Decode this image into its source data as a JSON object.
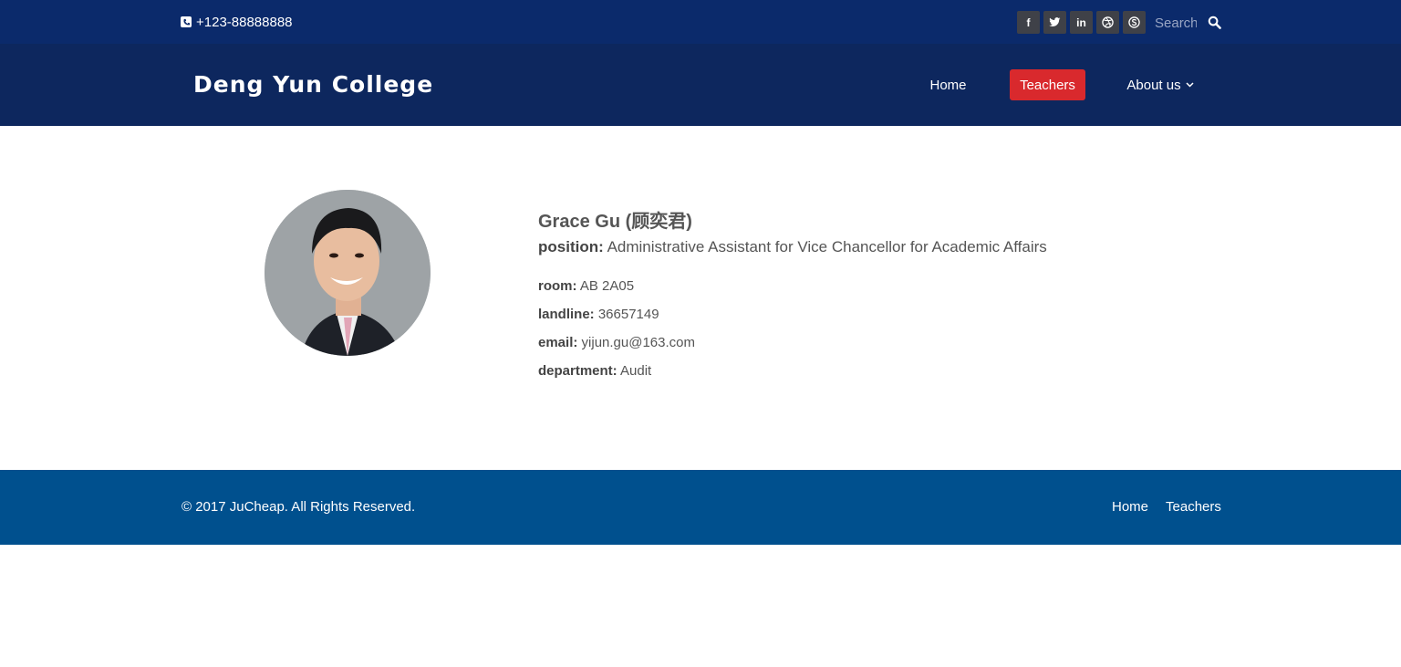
{
  "topbar": {
    "phone": "+123-88888888",
    "social": [
      {
        "glyph": "f",
        "icon": "facebook-icon"
      },
      {
        "glyph": "🐦",
        "icon": "twitter-icon"
      },
      {
        "glyph": "in",
        "icon": "linkedin-icon"
      },
      {
        "glyph": "◎",
        "icon": "dribbble-icon"
      },
      {
        "glyph": "S",
        "icon": "skype-icon"
      }
    ],
    "search": {
      "placeholder": "Search"
    }
  },
  "navbar": {
    "logo": "Deng Yun College",
    "items": [
      {
        "label": "Home"
      },
      {
        "label": "Teachers",
        "active": true
      },
      {
        "label": "About us",
        "dropdown_icon": "chevron-down-icon"
      }
    ],
    "active_color": "#d9292d"
  },
  "profile": {
    "name": "Grace Gu (顾奕君)",
    "position_label": "position:",
    "position": "Administrative Assistant for Vice Chancellor for Academic Affairs",
    "details": [
      {
        "label": "room:",
        "value": "AB 2A05"
      },
      {
        "label": "landline:",
        "value": "36657149"
      },
      {
        "label": "email:",
        "value": "yijun.gu@163.com"
      },
      {
        "label": "department:",
        "value": "Audit"
      }
    ]
  },
  "footer": {
    "copyright": "© 2017 JuCheap. All Rights Reserved.",
    "links": [
      {
        "label": "Home"
      },
      {
        "label": "Teachers"
      }
    ]
  },
  "colors": {
    "topbar": "#0b2a6b",
    "navbar": "#0d275e",
    "footer": "#00508e"
  }
}
